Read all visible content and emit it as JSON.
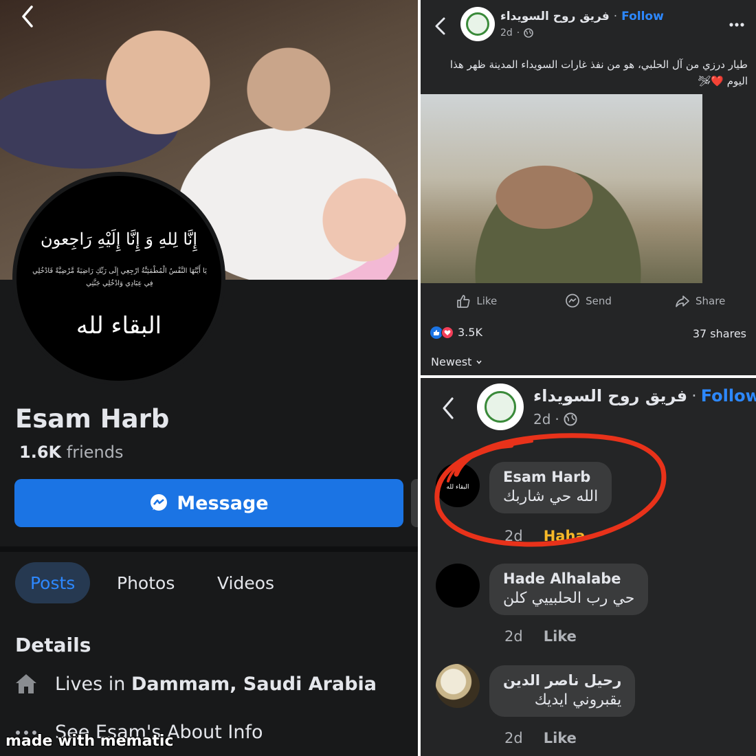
{
  "left_profile": {
    "avatar_verse_top": "إِنَّا لِلهِ وَ إِنَّا إِلَيْهِ رَاجِعون",
    "avatar_verse_mid": "يَا أَيَّتُهَا النَّفْسُ الْمُطْمَئِنَّةُ ارْجِعِي إِلَى رَبِّكِ رَاضِيَةً مَّرْضِيَّةً فَادْخُلِي فِي عِبَادِي وَادْخُلِي جَنَّتِي",
    "avatar_verse_bottom": "البقاء لله",
    "name": "Esam Harb",
    "friends_count": "1.6K",
    "friends_label": "friends",
    "message_label": "Message",
    "tabs": [
      {
        "label": "Posts"
      },
      {
        "label": "Photos"
      },
      {
        "label": "Videos"
      }
    ],
    "details_heading": "Details",
    "lives_prefix": "Lives in",
    "lives_city": "Dammam, Saudi Arabia",
    "about_label": "See Esam's About Info",
    "watermark": "made with mematic"
  },
  "post_top": {
    "page_name": "فريق روح السويداء",
    "separator": "·",
    "follow_label": "Follow",
    "time": "2d",
    "time_separator": "·",
    "caption": "طيار درزي من آل الحلبي، هو من نفذ غارات السويداء المدينة ظهر هذا اليوم ❤️🛩",
    "actions": [
      {
        "label": "Like",
        "icon": "thumbs-up-icon"
      },
      {
        "label": "Send",
        "icon": "messenger-icon"
      },
      {
        "label": "Share",
        "icon": "share-icon"
      }
    ],
    "reactions_count": "3.5K",
    "shares_count": "37 shares",
    "sort_label": "Newest"
  },
  "post_bottom": {
    "page_name": "فريق روح السويداء",
    "separator": "·",
    "follow_label": "Follow",
    "time": "2d",
    "time_separator": "·",
    "comments": [
      {
        "author": "Esam Harb",
        "text": "الله حي شاربك",
        "time": "2d",
        "action": "Haha",
        "avatar_text": "البقاء لله"
      },
      {
        "author": "Hade Alhalabe",
        "text": "حي رب الحلبييي كلن",
        "time": "2d",
        "action": "Like"
      },
      {
        "author": "رحيل ناصر الدين",
        "text": "يقبروني ايديك",
        "time": "2d",
        "action": "Like"
      }
    ]
  },
  "colors": {
    "background_dark": "#18191a",
    "card_dark": "#242526",
    "bubble": "#3a3b3c",
    "accent_blue": "#1b74e4",
    "link_blue": "#2d88ff",
    "haha_yellow": "#f7b928",
    "highlight_red": "#e8321a"
  }
}
